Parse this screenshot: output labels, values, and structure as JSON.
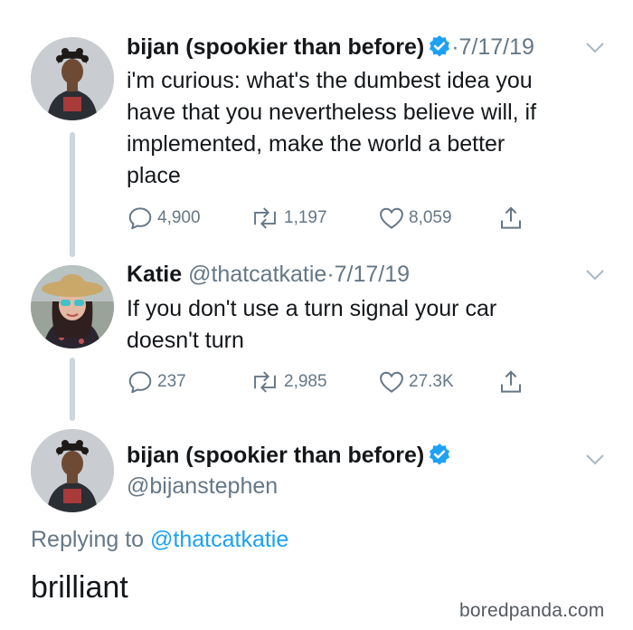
{
  "tweets": [
    {
      "author": "bijan (spookier than before)",
      "verified": true,
      "meta": "·7/17/19",
      "text": "i'm curious: what's the dumbest idea you have that you nevertheless believe will, if implemented, make the world a better place",
      "lines": [
        "i'm curious: what's the dumbest idea you",
        "have that you nevertheless believe will, if",
        "implemented, make the world a better",
        "place"
      ],
      "replies": "4,900",
      "retweets": "1,197",
      "likes": "8,059"
    },
    {
      "author": "Katie",
      "verified": false,
      "meta": "@thatcatkatie·7/17/19",
      "lines": [
        "If you don't use a turn signal your car",
        "doesn't turn"
      ],
      "replies": "237",
      "retweets": "2,985",
      "likes": "27.3K"
    }
  ],
  "main_tweet": {
    "author": "bijan (spookier than before)",
    "verified": true,
    "handle": "@bijanstephen",
    "replying_prefix": "Replying to ",
    "replying_handle": "@thatcatkatie",
    "text": "brilliant"
  },
  "watermark": "boredpanda.com",
  "colors": {
    "link": "#1da1f2",
    "muted": "#657786",
    "verified": "#1da1f2",
    "thread": "#ccd6dd"
  },
  "icons": [
    "reply-icon",
    "retweet-icon",
    "like-icon",
    "share-icon",
    "verified-badge-icon",
    "chevron-down-icon"
  ]
}
